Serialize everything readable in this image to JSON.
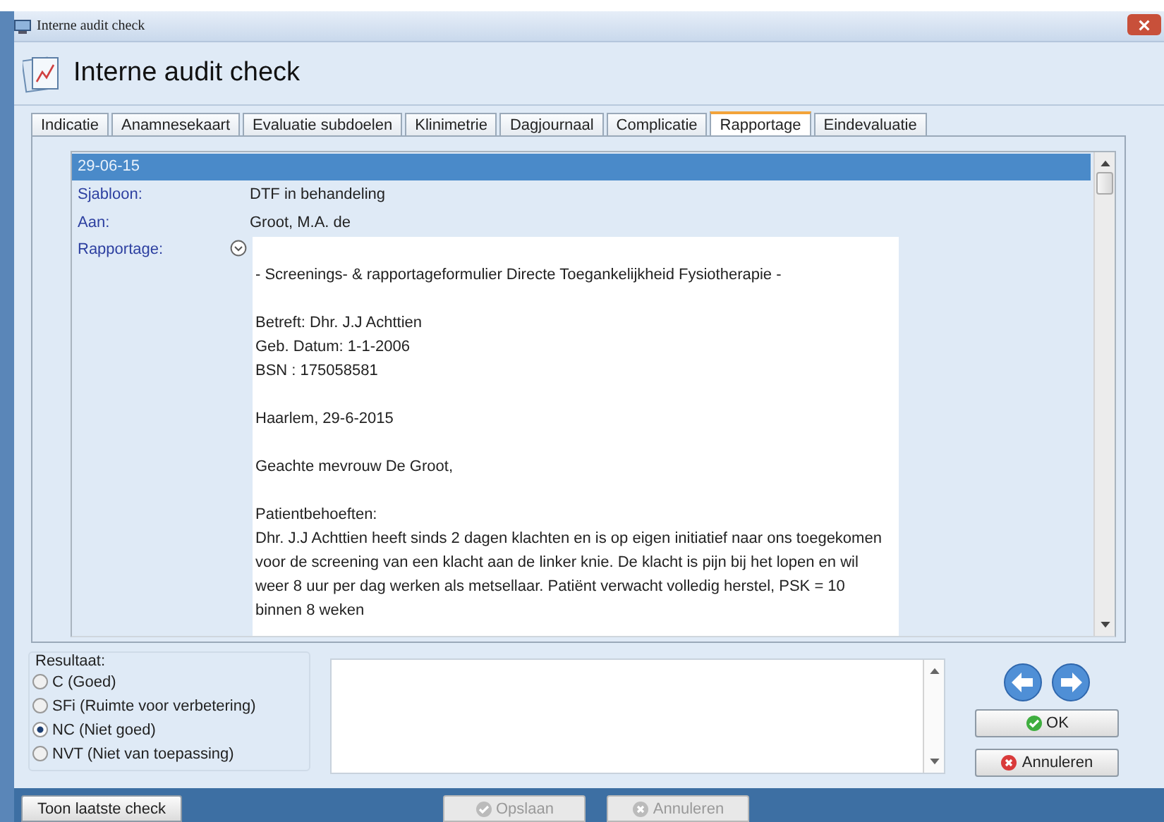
{
  "window": {
    "title": "Interne audit check",
    "heading": "Interne audit check"
  },
  "tabs": [
    {
      "label": "Indicatie",
      "selected": false
    },
    {
      "label": "Anamnesekaart",
      "selected": false
    },
    {
      "label": "Evaluatie subdoelen",
      "selected": false
    },
    {
      "label": "Klinimetrie",
      "selected": false
    },
    {
      "label": "Dagjournaal",
      "selected": false
    },
    {
      "label": "Complicatie",
      "selected": false
    },
    {
      "label": "Rapportage",
      "selected": true
    },
    {
      "label": "Eindevaluatie",
      "selected": false
    }
  ],
  "record": {
    "date": "29-06-15",
    "selected": true,
    "fields": [
      {
        "label": "Sjabloon:",
        "value": "DTF in behandeling"
      },
      {
        "label": "Aan:",
        "value": "Groot, M.A. de"
      }
    ],
    "report": {
      "label": "Rapportage:",
      "paragraphs": [
        [
          "- Screenings- & rapportageformulier Directe Toegankelijkheid Fysiotherapie -"
        ],
        [
          "Betreft: Dhr. J.J Achttien",
          "Geb. Datum: 1-1-2006",
          "BSN : 175058581"
        ],
        [
          "Haarlem, 29-6-2015"
        ],
        [
          "Geachte mevrouw De Groot,"
        ],
        [
          "Patientbehoeften:",
          "Dhr. J.J Achttien heeft sinds 2 dagen klachten en is op eigen initiatief naar ons toegekomen",
          "voor de screening van een klacht aan de linker knie. De klacht is pijn bij het lopen en wil",
          "weer 8 uur per dag werken als metsellaar. Patiënt verwacht volledig herstel, PSK = 10",
          "binnen 8 weken"
        ]
      ]
    }
  },
  "result": {
    "label": "Resultaat:",
    "options": [
      {
        "label": "C (Goed)",
        "selected": false
      },
      {
        "label": "SFi (Ruimte voor verbetering)",
        "selected": false
      },
      {
        "label": "NC (Niet goed)",
        "selected": true
      },
      {
        "label": "NVT (Niet van toepassing)",
        "selected": false
      }
    ]
  },
  "actions": [
    {
      "label": "OK",
      "kind": "ok"
    },
    {
      "label": "Annuleren",
      "kind": "cancel"
    }
  ],
  "footer": {
    "buttons": [
      {
        "label": "Toon laatste check",
        "kind": "plain",
        "disabled": false
      },
      {
        "label": "Opslaan",
        "kind": "ok",
        "disabled": true
      },
      {
        "label": "Annuleren",
        "kind": "cancel",
        "disabled": true
      }
    ]
  }
}
